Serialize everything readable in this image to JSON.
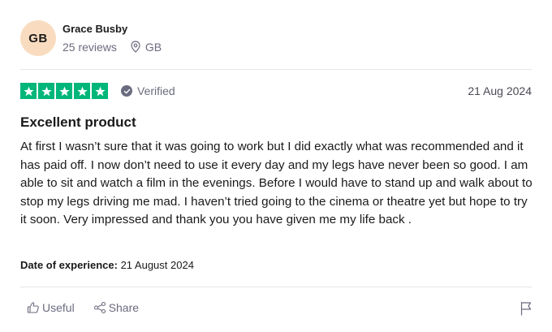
{
  "reviewer": {
    "initials": "GB",
    "name": "Grace Busby",
    "reviews_count": "25 reviews",
    "country": "GB"
  },
  "rating": {
    "stars": 5,
    "max_stars": 5,
    "verified_label": "Verified",
    "date": "21 Aug 2024"
  },
  "review": {
    "title": "Excellent product",
    "body": "At first I wasn’t sure that it was going to work but I did exactly what was recommended and it has paid off. I now don’t need to use it every day and my legs have never been so good. I am able to sit and watch a film in the evenings. Before I would have to stand up and walk about to stop my legs driving me mad. I haven’t tried going to the cinema or theatre yet but hope to try it soon. Very impressed and thank you you have given me my life back .",
    "experience_label": "Date of experience:",
    "experience_date": "21 August 2024"
  },
  "actions": {
    "useful_label": "Useful",
    "share_label": "Share"
  },
  "colors": {
    "star_green": "#00b67a",
    "avatar_bg": "#f9dcbf",
    "muted_text": "#6b6b7f"
  },
  "icons": {
    "location": "map-pin-icon",
    "verified": "check-circle-icon",
    "useful": "thumbs-up-icon",
    "share": "share-icon",
    "report": "flag-icon"
  }
}
